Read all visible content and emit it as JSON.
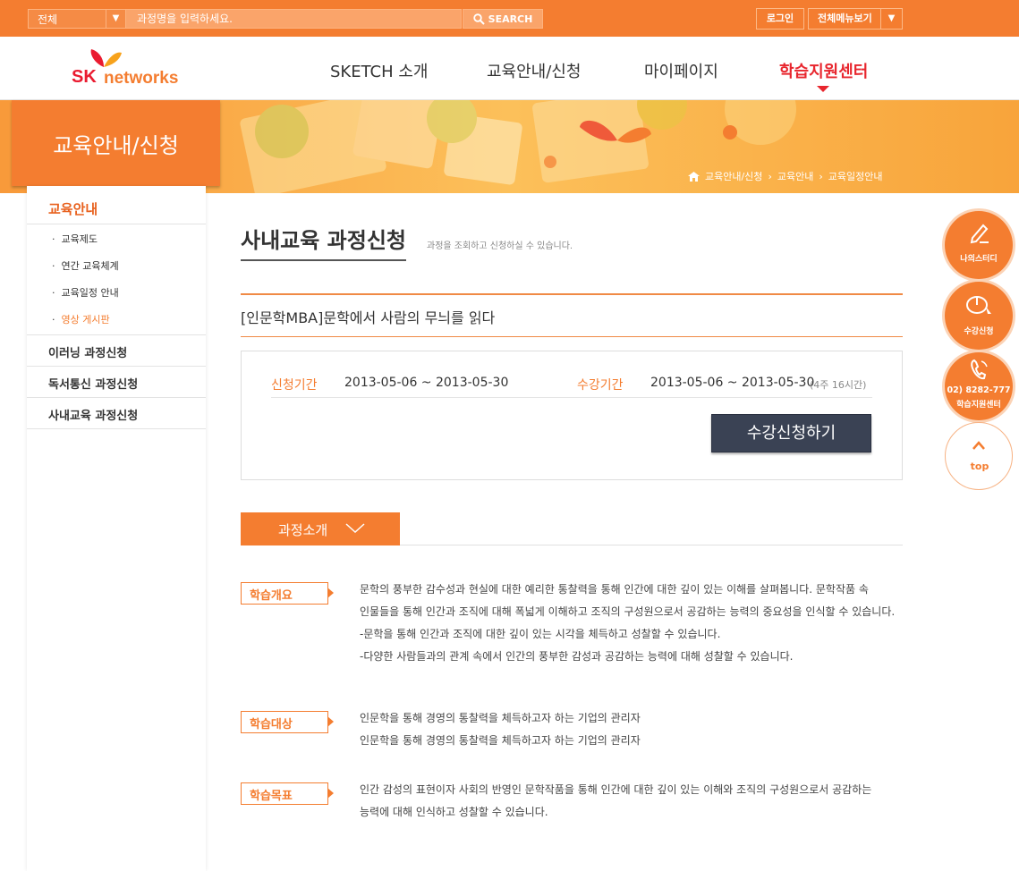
{
  "topbar": {
    "select_value": "전체",
    "search_placeholder": "과정명을 입력하세요.",
    "search_button": "SEARCH",
    "login": "로그인",
    "menu_all": "전체메뉴보기"
  },
  "logo": {
    "sk": "SK",
    "networks": "networks"
  },
  "gnb": [
    "SKETCH 소개",
    "교육안내/신청",
    "마이페이지",
    "학습지원센터"
  ],
  "banner": {
    "title": "교육안내/신청",
    "breadcrumb": [
      "교육안내/신청",
      "교육안내",
      "교육일정안내"
    ]
  },
  "sidebar": {
    "heading": "교육안내",
    "sub_items": [
      "교육제도",
      "연간 교육체계",
      "교육일정 안내",
      "영상 게시판"
    ],
    "items": [
      "이러닝 과정신청",
      "독서통신 과정신청",
      "사내교육 과정신청"
    ]
  },
  "main": {
    "title": "사내교육 과정신청",
    "description": "과정을 조회하고 신청하실 수 있습니다.",
    "course_title": "[인문학MBA]문학에서 사람의 무늬를 읽다",
    "apply_period_label": "신청기간",
    "apply_period": "2013-05-06 ~ 2013-05-30",
    "study_period_label": "수강기간",
    "study_period": "2013-05-06 ~ 2013-05-30",
    "study_period_note": "(4주 16시간)",
    "apply_button": "수강신청하기",
    "tab_label": "과정소개",
    "sections": [
      {
        "tag": "학습개요",
        "lines": [
          "문학의 풍부한 감수성과 현실에 대한 예리한 통찰력을 통해 인간에 대한 깊이 있는 이해를 살펴봅니다. 문학작품 속",
          "인물들을 통해 인간과 조직에 대해 폭넓게 이해하고 조직의 구성원으로서 공감하는 능력의 중요성을 인식할 수 있습니다.",
          "-문학을 통해 인간과 조직에 대한 깊이 있는 시각을 체득하고 성찰할 수 있습니다.",
          "-다양한 사람들과의 관계 속에서 인간의 풍부한 감성과 공감하는 능력에 대해 성찰할 수 있습니다."
        ]
      },
      {
        "tag": "학습대상",
        "lines": [
          "인문학을 통해 경영의 통찰력을 체득하고자 하는 기업의 관리자",
          "인문학을 통해 경영의 통찰력을 체득하고자 하는 기업의 관리자"
        ]
      },
      {
        "tag": "학습목표",
        "lines": [
          "인간 감성의 표현이자 사회의 반영인 문학작품을 통해 인간에 대한 깊이 있는 이해와 조직의 구성원으로서 공감하는",
          "능력에 대해 인식하고 성찰할 수 있습니다."
        ]
      }
    ]
  },
  "quick_menu": {
    "study": "나의스터디",
    "enroll": "수강신청",
    "phone": "02) 8282-777",
    "center": "학습지원센터",
    "top": "top"
  },
  "colors": {
    "brand_orange": "#f47d30",
    "brand_red": "#e8262e",
    "navy_button": "#3a4254"
  }
}
